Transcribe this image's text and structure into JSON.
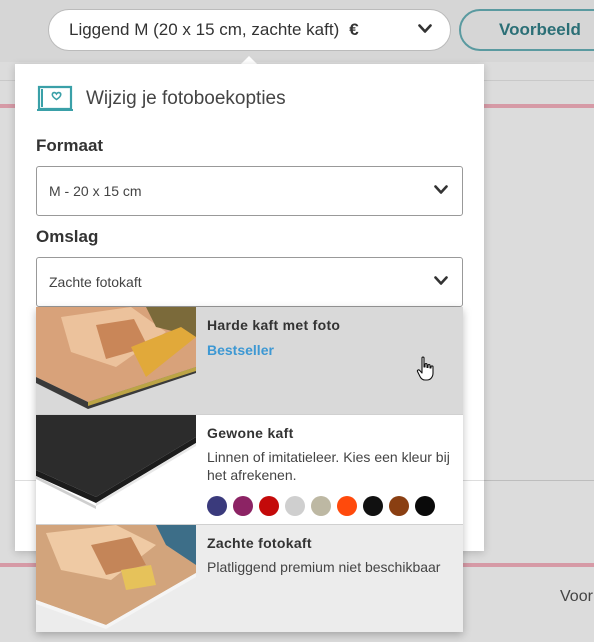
{
  "header": {
    "product_label": "Liggend M (20 x 15 cm, zachte kaft)",
    "currency": "€",
    "preview_label": "Voorbeeld"
  },
  "background": {
    "partial_text": "Voor"
  },
  "panel": {
    "title": "Wijzig je fotoboekopties",
    "format_label": "Formaat",
    "format_value": "M - 20 x 15 cm",
    "cover_label": "Omslag",
    "cover_value": "Zachte fotokaft"
  },
  "cover_options": [
    {
      "name": "Harde kaft met foto",
      "badge": "Bestseller",
      "state": "hovered"
    },
    {
      "name": "Gewone kaft",
      "description": "Linnen of imitatieleer. Kies een kleur bij het afrekenen.",
      "colors": [
        "#3a3a7c",
        "#8c2364",
        "#c40a0a",
        "#cfcfcf",
        "#bdb8a3",
        "#ff4a0c",
        "#111111",
        "#8a3f12",
        "#0a0a0a"
      ]
    },
    {
      "name": "Zachte fotokaft",
      "description": "Platliggend premium niet beschikbaar"
    }
  ],
  "colors": {
    "accent_link": "#3d98d3",
    "preview_border": "#5a9aa0",
    "hover_bg": "#d9d9d9",
    "selected_bg": "#ececec"
  }
}
